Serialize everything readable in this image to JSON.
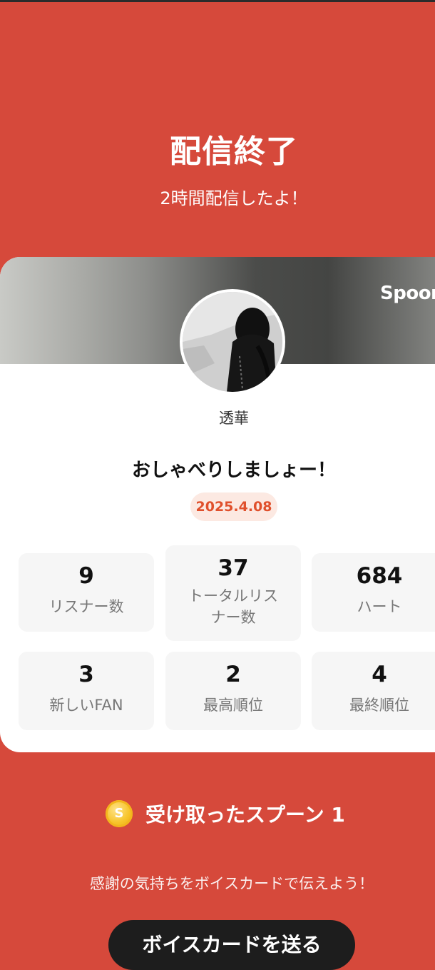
{
  "header": {
    "title": "配信終了",
    "subtitle": "2時間配信したよ！"
  },
  "card": {
    "brand": "Spoon",
    "username": "透華",
    "live_title": "おしゃべりしましょー！",
    "date": "2025.4.08",
    "stats": [
      {
        "value": "9",
        "label": "リスナー数"
      },
      {
        "value": "37",
        "label": "トータルリスナー数"
      },
      {
        "value": "684",
        "label": "ハート"
      },
      {
        "value": "3",
        "label": "新しいFAN"
      },
      {
        "value": "2",
        "label": "最高順位"
      },
      {
        "value": "4",
        "label": "最終順位"
      }
    ]
  },
  "spoons": {
    "coin_symbol": "S",
    "text": "受け取ったスプーン 1"
  },
  "footer": {
    "thanks": "感謝の気持ちをボイスカードで伝えよう！",
    "button_label": "ボイスカードを送る"
  },
  "colors": {
    "background": "#D6493B",
    "accent": "#E0502C",
    "card": "#FFFFFF",
    "button": "#1D1D1D"
  }
}
